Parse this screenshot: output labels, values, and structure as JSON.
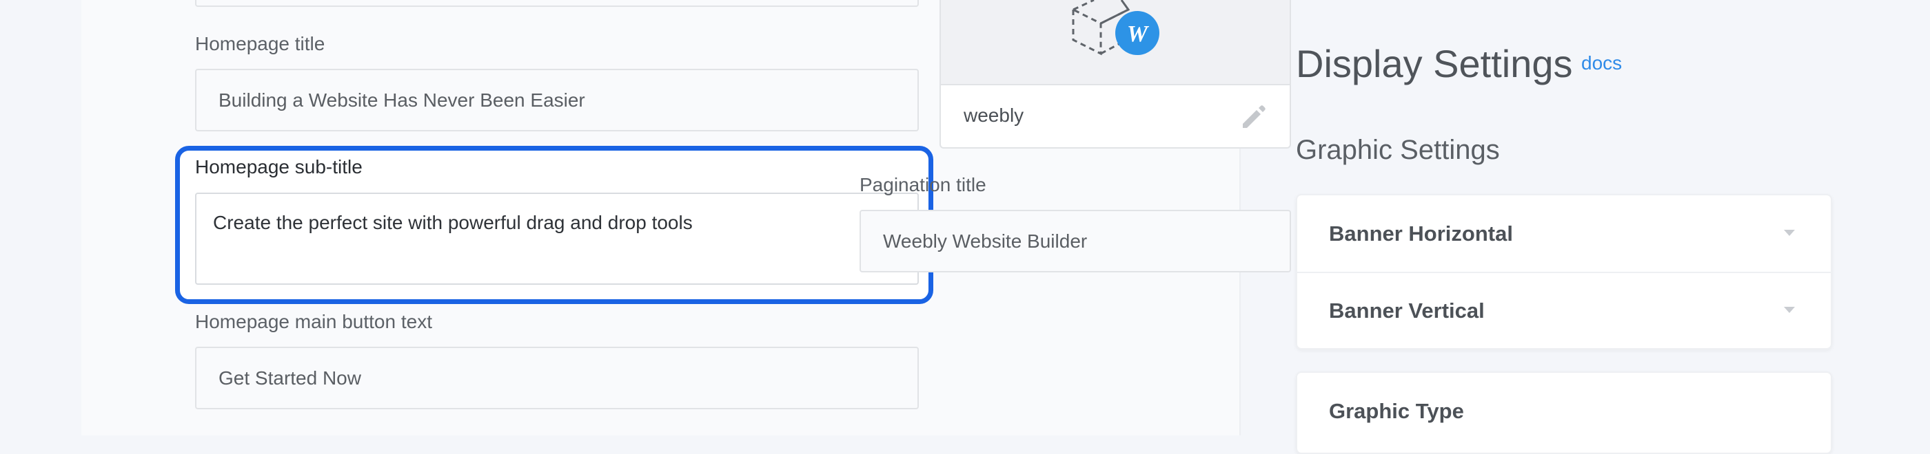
{
  "form": {
    "homepage_title": {
      "label": "Homepage title",
      "value": "Building a Website Has Never Been Easier"
    },
    "homepage_subtitle": {
      "label": "Homepage sub-title",
      "value": "Create the perfect site with powerful drag and drop tools"
    },
    "main_button_text": {
      "label": "Homepage main button text",
      "value": "Get Started Now"
    }
  },
  "theme_card": {
    "name": "weebly",
    "badge_letter": "W"
  },
  "pagination": {
    "label": "Pagination title",
    "value": "Weebly Website Builder"
  },
  "display_settings": {
    "title": "Display Settings",
    "docs_label": "docs",
    "graphic_settings_title": "Graphic Settings",
    "items": [
      {
        "label": "Banner Horizontal"
      },
      {
        "label": "Banner Vertical"
      },
      {
        "label": "Graphic Type"
      }
    ]
  },
  "colors": {
    "accent": "#1a63e4",
    "link": "#2f8be8",
    "badge": "#2d93e6"
  }
}
